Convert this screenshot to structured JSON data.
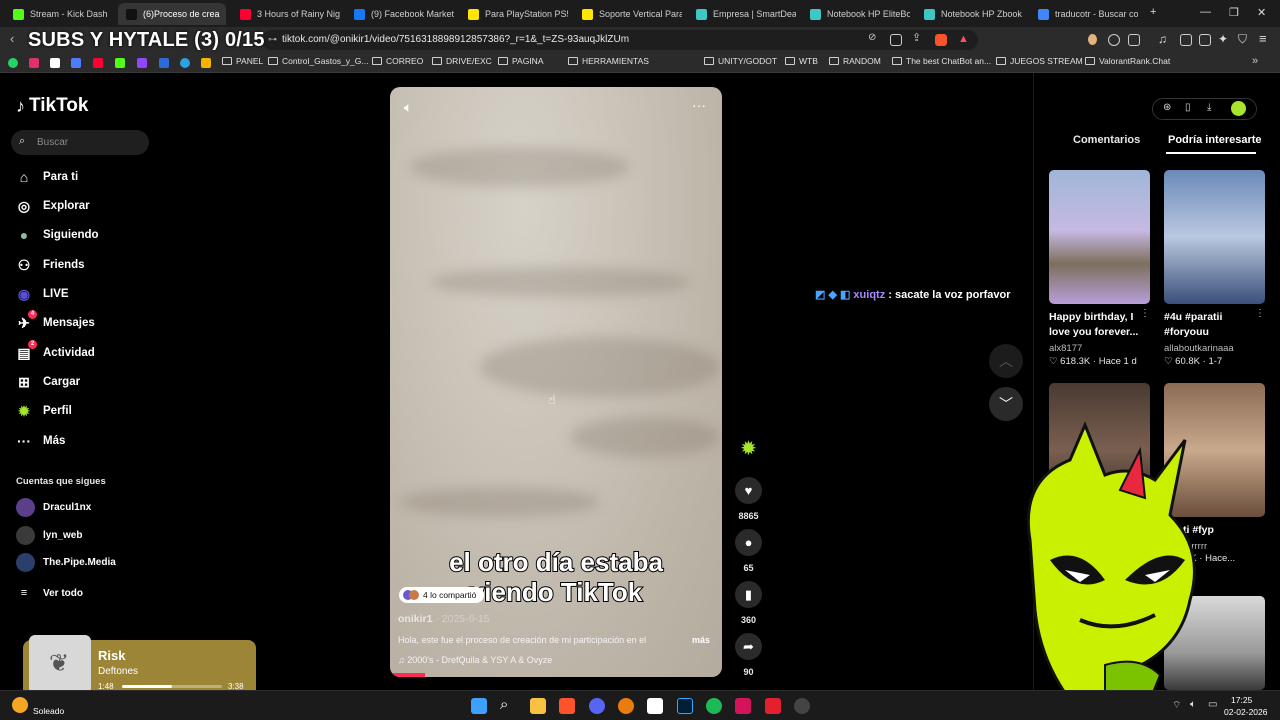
{
  "overlay_title": "SUBS Y HYTALE (3) 0/15",
  "browser": {
    "tabs": [
      {
        "label": "Stream - Kick Dash",
        "color": "#53fc18"
      },
      {
        "label": "(6)Proceso de crea",
        "color": "#111111",
        "active": true
      },
      {
        "label": "3 Hours of Rainy Night",
        "color": "#ff0033"
      },
      {
        "label": "(9) Facebook Marketpl",
        "color": "#1877f2"
      },
      {
        "label": "Para PlayStation PS5 -",
        "color": "#ffe600"
      },
      {
        "label": "Soporte Vertical Para P",
        "color": "#ffe600"
      },
      {
        "label": "Empresa | SmartDeal.cl",
        "color": "#3fc6c6"
      },
      {
        "label": "Notebook HP EliteBoo",
        "color": "#3fc6c6"
      },
      {
        "label": "Notebook HP Zbook F",
        "color": "#3fc6c6"
      },
      {
        "label": "traducotr - Buscar con",
        "color": "#4285f4"
      }
    ],
    "url": "tiktok.com/@onikir1/video/7516318898912857386?_r=1&_t=ZS-93auqJklZUm",
    "bookmarks": [
      "PANEL",
      "Control_Gastos_y_G...",
      "CORREO",
      "DRIVE/EXC",
      "PAGINA",
      "HERRAMIENTAS",
      "UNITY/GODOT",
      "WTB",
      "RANDOM",
      "The best ChatBot an...",
      "JUEGOS STREAM",
      "ValorantRank.Chat"
    ]
  },
  "tiktok": {
    "logo": "TikTok",
    "search_placeholder": "Buscar",
    "nav": [
      {
        "label": "Para ti",
        "icon": "home-icon"
      },
      {
        "label": "Explorar",
        "icon": "compass-icon"
      },
      {
        "label": "Siguiendo",
        "icon": "following-avatar-icon"
      },
      {
        "label": "Friends",
        "icon": "friends-icon"
      },
      {
        "label": "LIVE",
        "icon": "live-icon"
      },
      {
        "label": "Mensajes",
        "icon": "messages-icon",
        "badge": "4"
      },
      {
        "label": "Actividad",
        "icon": "activity-icon",
        "badge": "2"
      },
      {
        "label": "Cargar",
        "icon": "upload-icon"
      },
      {
        "label": "Perfil",
        "icon": "profile-icon"
      },
      {
        "label": "Más",
        "icon": "more-icon"
      }
    ],
    "following_title": "Cuentas que sigues",
    "following": [
      {
        "name": "Dracul1nx"
      },
      {
        "name": "lyn_web"
      },
      {
        "name": "The.Pipe.Media"
      }
    ],
    "see_all": "Ver todo",
    "video": {
      "caption_line1": "el otro día estaba",
      "caption_line2": "viendo TikTok",
      "shared": "4 lo compartió",
      "author": "onikir1",
      "date": " · 2025-6-15",
      "description": "Hola, este fue el proceso de creación de mi participación en el",
      "more": "más",
      "music": "2000's - DrefQuila & YSY A & Ovyze"
    },
    "actions": {
      "likes": "8865",
      "comments": "65",
      "saves": "360",
      "shares": "90"
    },
    "right_panel": {
      "tabs": [
        "Comentarios",
        "Podría interesarte"
      ],
      "cards": [
        {
          "title": "Happy birthday, I love you forever...",
          "author": "alx8177",
          "likes": "618.3K",
          "time": "Hace 1 d"
        },
        {
          "title": "#4u #paratii #foryouu",
          "author": "allaboutkarinaaa",
          "likes": "60.8K",
          "time": "1-7"
        },
        {
          "title": "",
          "author": "",
          "likes": "",
          "time": ""
        },
        {
          "title": "ti #fyp",
          "author": "rrrrrrr",
          "likes": "6K",
          "time": "Hace..."
        }
      ]
    }
  },
  "chat": {
    "user": "xuiqtz",
    "message": " : sacate la voz porfavor"
  },
  "music_widget": {
    "title": "Risk",
    "artist": "Deftones",
    "current": "1:48",
    "duration": "3:38",
    "progress": 0.5
  },
  "taskbar": {
    "weather": "Soleado",
    "time": "17:25",
    "date": "02-02-2026"
  }
}
